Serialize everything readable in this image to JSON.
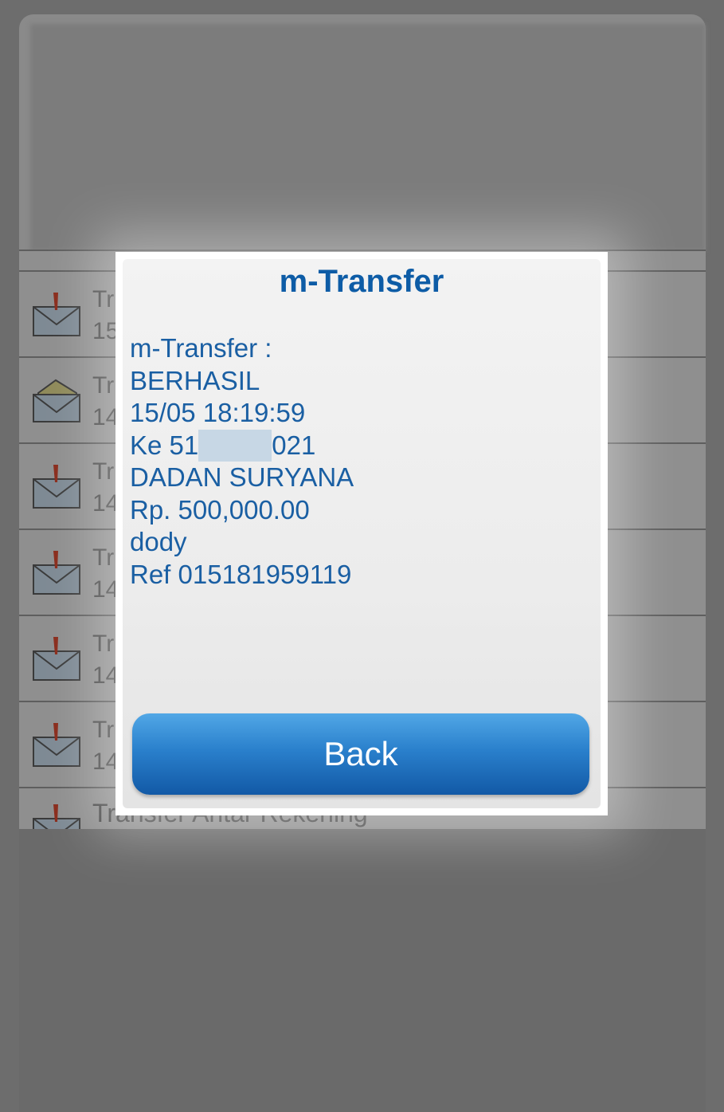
{
  "background_list": {
    "rows": [
      {
        "title": "Tr",
        "date": "15",
        "icon": "urgent-envelope-icon"
      },
      {
        "title": "Tr",
        "date": "14",
        "icon": "opened-envelope-icon"
      },
      {
        "title": "Tr",
        "date": "14",
        "icon": "urgent-envelope-icon"
      },
      {
        "title": "Tr",
        "date": "14",
        "icon": "urgent-envelope-icon"
      },
      {
        "title": "Tr",
        "date": "14",
        "icon": "urgent-envelope-icon"
      },
      {
        "title": "Tr",
        "date": "14",
        "icon": "urgent-envelope-icon"
      }
    ],
    "last_row_label": "Transfer Antar Rekening"
  },
  "dialog": {
    "title": "m-Transfer",
    "message": {
      "header": "m-Transfer :",
      "status": "BERHASIL",
      "datetime": "15/05 18:19:59",
      "account_prefix": "Ke 51",
      "account_suffix": "021",
      "recipient": "DADAN SURYANA",
      "amount": "Rp. 500,000.00",
      "note": "dody",
      "reference": "Ref 015181959119"
    },
    "back_label": "Back"
  },
  "colors": {
    "title": "#0d5ca6",
    "text": "#1a5fa3",
    "button_top": "#51a7e6",
    "button_bottom": "#1259a6"
  }
}
